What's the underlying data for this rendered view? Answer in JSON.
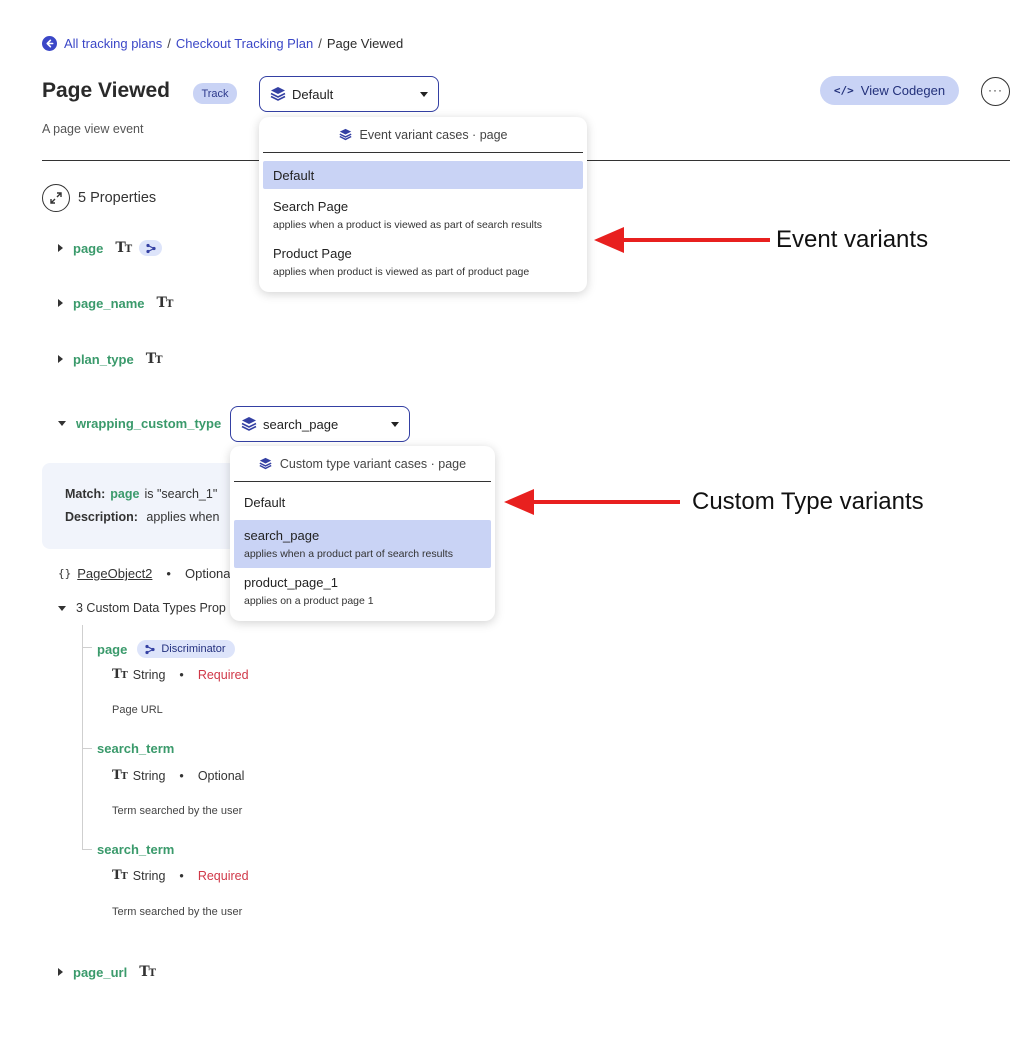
{
  "breadcrumb": {
    "all_plans": "All tracking plans",
    "separator": "/",
    "plan": "Checkout Tracking Plan",
    "current": "Page Viewed"
  },
  "header": {
    "title": "Page Viewed",
    "badge": "Track",
    "variant_selected": "Default",
    "description": "A page view event",
    "codegen_label": "View Codegen",
    "codegen_icon": "</>",
    "more_icon": "···"
  },
  "properties": {
    "count_label": "5 Properties",
    "items": [
      {
        "name": "page"
      },
      {
        "name": "page_name"
      },
      {
        "name": "plan_type"
      },
      {
        "name": "wrapping_custom_type",
        "variant_selected": "search_page"
      },
      {
        "name": "page_url"
      }
    ],
    "tt_icon": "T",
    "tt_small": "T"
  },
  "match": {
    "match_label": "Match:",
    "match_prop": "page",
    "match_value": "is \"search_1\"",
    "description_label": "Description:",
    "description_value": "applies when"
  },
  "object_row": {
    "braces": "{}",
    "name": "PageObject2",
    "bullet": "•",
    "optional": "Optional"
  },
  "custom_types": {
    "label": "3 Custom Data Types Prop",
    "children": [
      {
        "name": "page",
        "badge": "Discriminator",
        "type": "String",
        "bullet": "•",
        "requirement": "Required",
        "description": "Page URL"
      },
      {
        "name": "search_term",
        "type": "String",
        "bullet": "•",
        "requirement": "Optional",
        "description": "Term searched by the user"
      },
      {
        "name": "search_term",
        "type": "String",
        "bullet": "•",
        "requirement": "Required",
        "description": "Term searched by the user"
      }
    ]
  },
  "event_variants_menu": {
    "header": "Event variant cases · page",
    "items": [
      {
        "label": "Default",
        "sub": ""
      },
      {
        "label": "Search Page",
        "sub": "applies when a product is viewed as part of search results"
      },
      {
        "label": "Product Page",
        "sub": "applies when product is viewed as part of product page"
      }
    ]
  },
  "custom_variants_menu": {
    "header": "Custom type variant cases · page",
    "items": [
      {
        "label": "Default",
        "sub": ""
      },
      {
        "label": "search_page",
        "sub": "applies when a product part of search results"
      },
      {
        "label": "product_page_1",
        "sub": "applies on a product page 1"
      }
    ]
  },
  "annotations": {
    "event": "Event variants",
    "custom": "Custom Type variants"
  },
  "colors": {
    "accent": "#3b47c7",
    "property_green": "#3a9a6b",
    "required_red": "#d03848",
    "highlight": "#c9d3f5",
    "arrow_red": "#e8201f"
  }
}
